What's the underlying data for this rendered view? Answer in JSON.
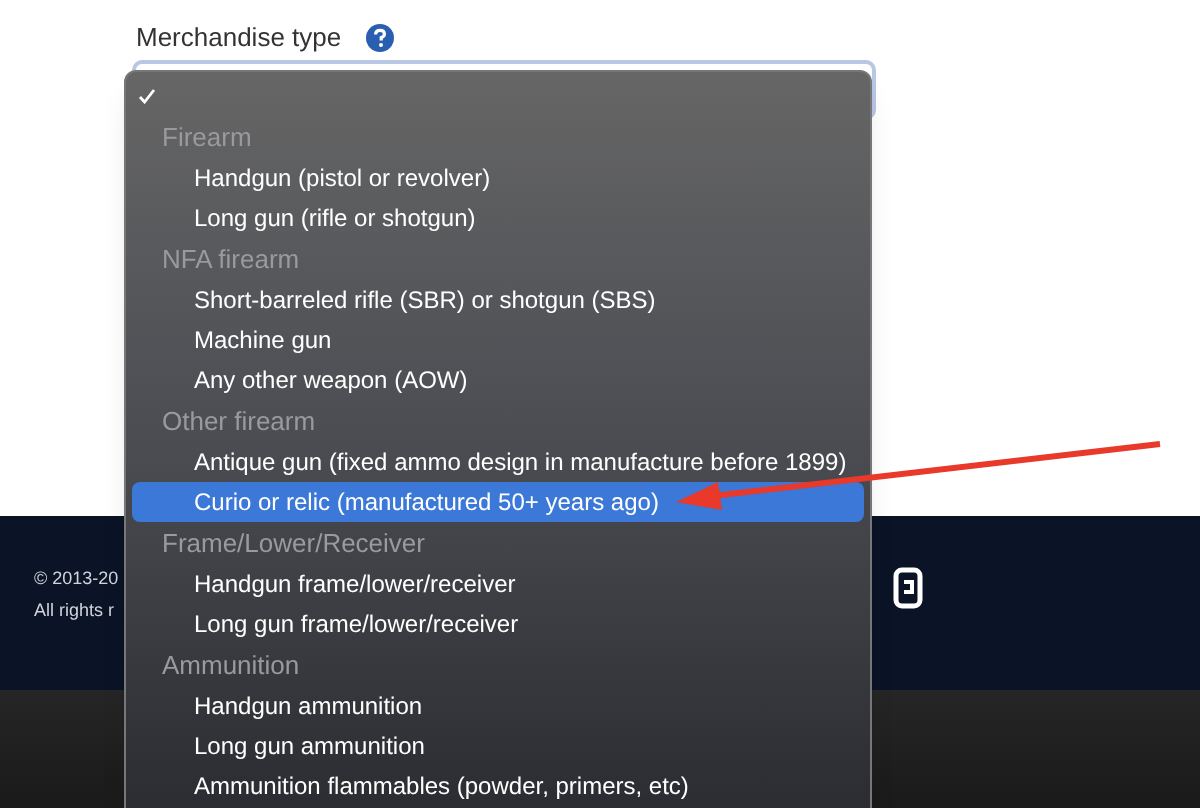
{
  "form": {
    "label": "Merchandise type"
  },
  "footer": {
    "lines": [
      "© 2013-20",
      "All rights r"
    ]
  },
  "menu": {
    "items": [
      {
        "kind": "check",
        "checked": true
      },
      {
        "kind": "group",
        "label": "Firearm"
      },
      {
        "kind": "option",
        "label": "Handgun (pistol or revolver)",
        "selected": false
      },
      {
        "kind": "option",
        "label": "Long gun (rifle or shotgun)",
        "selected": false
      },
      {
        "kind": "group",
        "label": "NFA firearm"
      },
      {
        "kind": "option",
        "label": "Short-barreled rifle (SBR) or shotgun (SBS)",
        "selected": false
      },
      {
        "kind": "option",
        "label": "Machine gun",
        "selected": false
      },
      {
        "kind": "option",
        "label": "Any other weapon (AOW)",
        "selected": false
      },
      {
        "kind": "group",
        "label": "Other firearm"
      },
      {
        "kind": "option",
        "label": "Antique gun (fixed ammo design in manufacture before 1899)",
        "selected": false
      },
      {
        "kind": "option",
        "label": "Curio or relic (manufactured 50+ years ago)",
        "selected": true
      },
      {
        "kind": "group",
        "label": "Frame/Lower/Receiver"
      },
      {
        "kind": "option",
        "label": "Handgun frame/lower/receiver",
        "selected": false
      },
      {
        "kind": "option",
        "label": "Long gun frame/lower/receiver",
        "selected": false
      },
      {
        "kind": "group",
        "label": "Ammunition"
      },
      {
        "kind": "option",
        "label": "Handgun ammunition",
        "selected": false
      },
      {
        "kind": "option",
        "label": "Long gun ammunition",
        "selected": false
      },
      {
        "kind": "option",
        "label": "Ammunition flammables (powder, primers, etc)",
        "selected": false
      }
    ]
  }
}
